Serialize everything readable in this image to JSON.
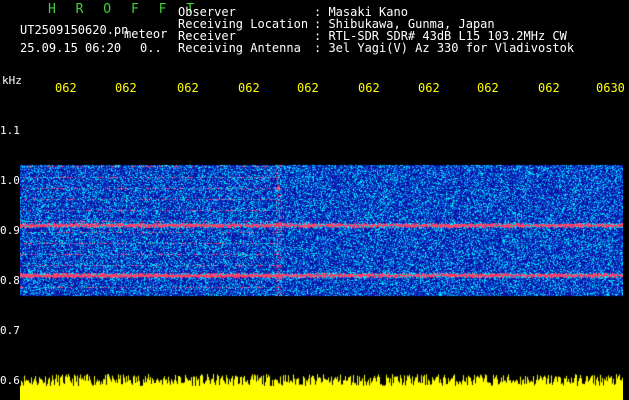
{
  "header": {
    "brand": "H R O F F T",
    "filename": "UT2509150620.pn",
    "meteor_label": "meteor",
    "datetime": "25.09.15 06:20",
    "count": "0.."
  },
  "info": [
    {
      "label": "Observer",
      "value": ": Masaki Kano"
    },
    {
      "label": "Receiving Location",
      "value": ": Shibukawa, Gunma, Japan"
    },
    {
      "label": "Receiver",
      "value": ": RTL-SDR SDR# 43dB L15 103.2MHz CW"
    },
    {
      "label": "Receiving Antenna",
      "value": ": 3el Yagi(V) Az 330 for Vladivostok"
    }
  ],
  "y_unit": "kHz",
  "time_ticks": [
    "062",
    "062",
    "062",
    "062",
    "062",
    "062",
    "062",
    "062",
    "062",
    "0630"
  ],
  "y_ticks": [
    "1.1",
    "1.0",
    "0.9",
    "0.8",
    "0.7",
    "0.6"
  ],
  "colors": {
    "background": "#000000",
    "text": "#ffffff",
    "brand": "#3fd13f",
    "tick": "#ffff00",
    "amplitude": "#ffff00",
    "noise_low": "#0a1aa0",
    "noise_mid": "#00c8ff",
    "signal": "#ff3060"
  },
  "spectrum": {
    "freq_range_khz": [
      0.77,
      1.03
    ],
    "carrier_lines_khz": [
      0.81,
      0.91
    ]
  }
}
